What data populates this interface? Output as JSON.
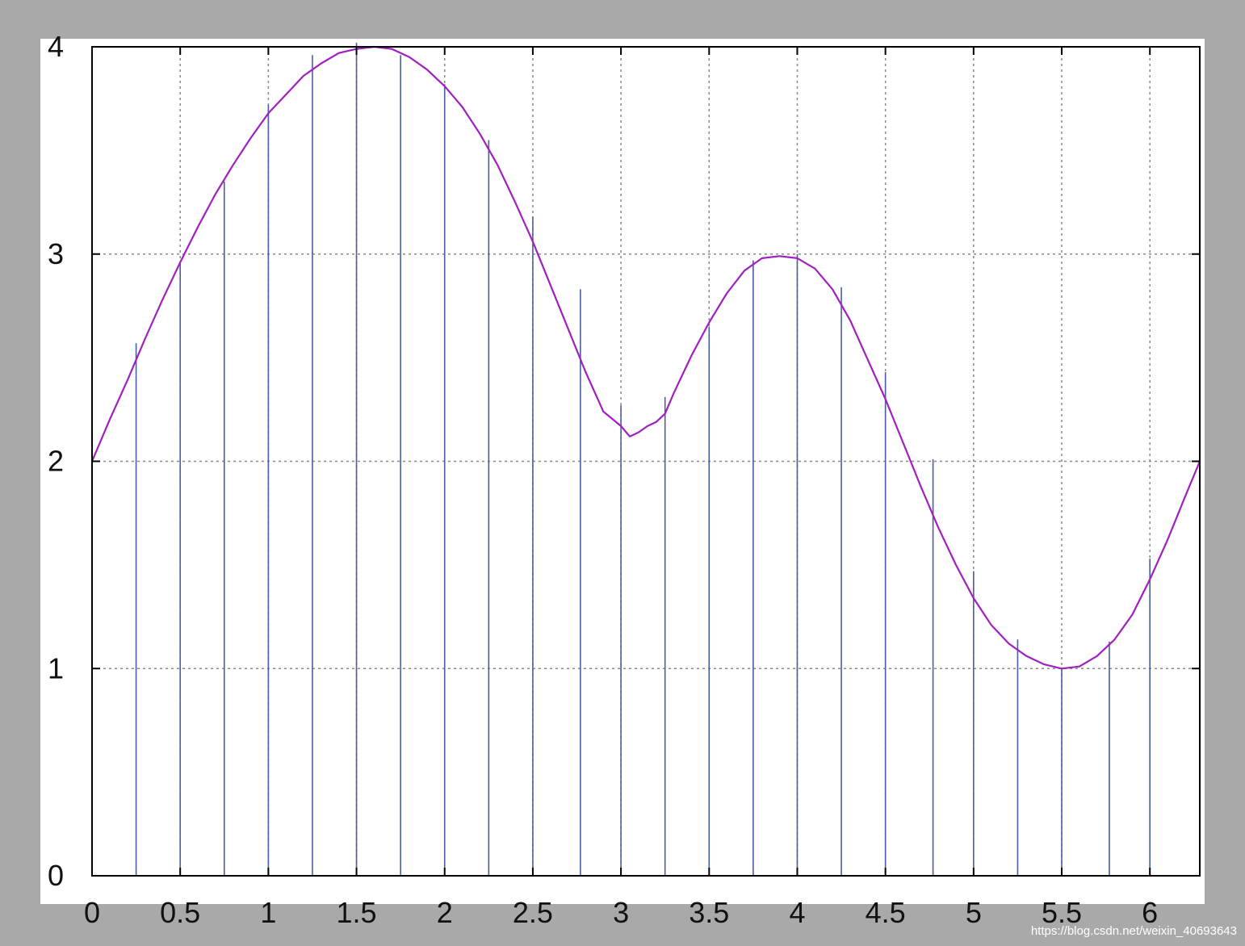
{
  "chart_data": {
    "type": "line",
    "title": "",
    "xlabel": "",
    "ylabel": "",
    "xlim": [
      0,
      6.283
    ],
    "ylim": [
      0,
      4
    ],
    "grid": true,
    "x_ticks": [
      0,
      0.5,
      1,
      1.5,
      2,
      2.5,
      3,
      3.5,
      4,
      4.5,
      5,
      5.5,
      6
    ],
    "x_tick_labels": [
      "0",
      "0.5",
      "1",
      "1.5",
      "2",
      "2.5",
      "3",
      "3.5",
      "4",
      "4.5",
      "5",
      "5.5",
      "6"
    ],
    "y_ticks": [
      0,
      1,
      2,
      3,
      4
    ],
    "y_tick_labels": [
      "0",
      "1",
      "2",
      "3",
      "4"
    ],
    "series": [
      {
        "kind": "line",
        "color": "#a020c0",
        "x": [
          0,
          0.1,
          0.2,
          0.3,
          0.4,
          0.5,
          0.6,
          0.7,
          0.8,
          0.9,
          1.0,
          1.1,
          1.2,
          1.3,
          1.4,
          1.5,
          1.6,
          1.7,
          1.8,
          1.9,
          2.0,
          2.1,
          2.2,
          2.3,
          2.4,
          2.5,
          2.6,
          2.7,
          2.8,
          2.9,
          3.0,
          3.05,
          3.1,
          3.15,
          3.2,
          3.25,
          3.3,
          3.4,
          3.5,
          3.6,
          3.7,
          3.8,
          3.9,
          4.0,
          4.1,
          4.2,
          4.3,
          4.4,
          4.5,
          4.6,
          4.7,
          4.8,
          4.9,
          5.0,
          5.1,
          5.2,
          5.3,
          5.4,
          5.5,
          5.6,
          5.7,
          5.8,
          5.9,
          6.0,
          6.1,
          6.2,
          6.283
        ],
        "y": [
          2.0,
          2.2,
          2.39,
          2.59,
          2.78,
          2.96,
          3.13,
          3.29,
          3.43,
          3.56,
          3.68,
          3.77,
          3.86,
          3.92,
          3.97,
          3.99,
          4.0,
          3.99,
          3.95,
          3.89,
          3.81,
          3.71,
          3.58,
          3.43,
          3.25,
          3.06,
          2.85,
          2.64,
          2.43,
          2.24,
          2.17,
          2.12,
          2.14,
          2.17,
          2.19,
          2.23,
          2.33,
          2.51,
          2.67,
          2.81,
          2.92,
          2.98,
          2.99,
          2.98,
          2.93,
          2.83,
          2.68,
          2.49,
          2.3,
          2.09,
          1.88,
          1.68,
          1.5,
          1.34,
          1.21,
          1.12,
          1.06,
          1.02,
          1.0,
          1.01,
          1.06,
          1.14,
          1.26,
          1.43,
          1.62,
          1.83,
          2.0
        ]
      },
      {
        "kind": "stem",
        "color": "#4a5fa0",
        "x": [
          0.25,
          0.5,
          0.75,
          1.0,
          1.25,
          1.5,
          1.75,
          2.0,
          2.25,
          2.5,
          2.77,
          3.0,
          3.25,
          3.5,
          3.75,
          4.0,
          4.25,
          4.5,
          4.77,
          5.0,
          5.25,
          5.5,
          5.77,
          6.0
        ],
        "y": [
          2.57,
          2.96,
          3.35,
          3.72,
          3.96,
          4.02,
          3.96,
          3.82,
          3.55,
          3.18,
          2.83,
          2.27,
          2.31,
          2.65,
          2.97,
          3.0,
          2.84,
          2.43,
          2.01,
          1.47,
          1.14,
          1.0,
          1.13,
          1.53
        ]
      }
    ]
  },
  "watermark": "https://blog.csdn.net/weixin_40693643"
}
